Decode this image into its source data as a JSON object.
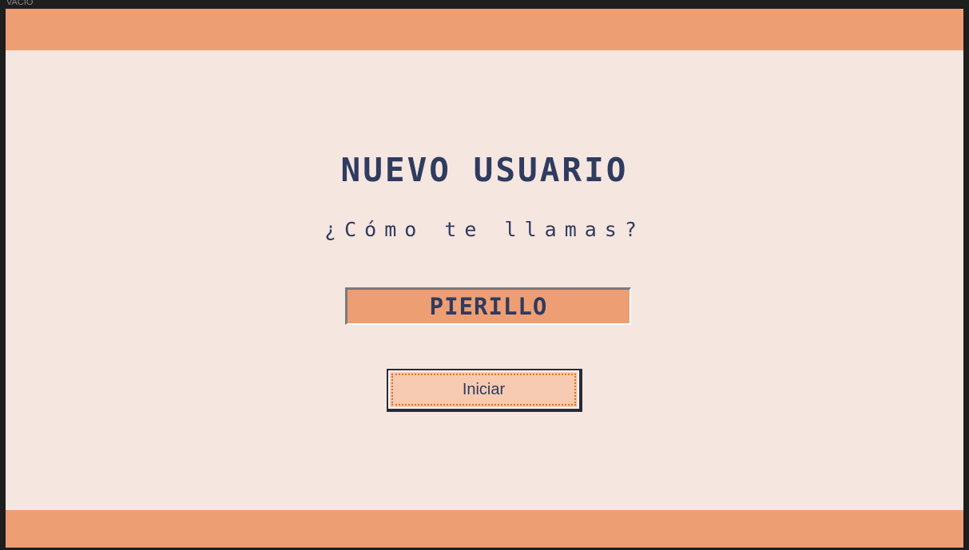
{
  "window": {
    "title": "VACIO"
  },
  "colors": {
    "accent": "#ed9e73",
    "background": "#f5e6e0",
    "text": "#2f3b5f",
    "button_face": "#f6cbb2",
    "focus_ring": "#e07020"
  },
  "screen": {
    "heading": "NUEVO USUARIO",
    "question": "¿Cómo te llamas?",
    "name_input": {
      "value": "PIERILLO",
      "placeholder": ""
    },
    "start_button": {
      "label": "Iniciar"
    }
  }
}
